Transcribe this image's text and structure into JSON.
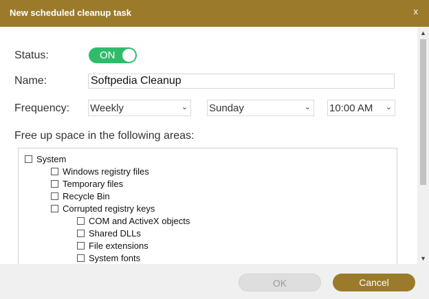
{
  "window": {
    "title": "New scheduled cleanup task",
    "close_label": "x"
  },
  "status": {
    "label": "Status:",
    "toggle_text": "ON"
  },
  "name": {
    "label": "Name:",
    "value": "Softpedia Cleanup"
  },
  "frequency": {
    "label": "Frequency:",
    "period": "Weekly",
    "day": "Sunday",
    "time": "10:00 AM"
  },
  "areas": {
    "heading": "Free up space in the following areas:",
    "items": [
      {
        "label": "System",
        "level": 0,
        "checked": false
      },
      {
        "label": "Windows registry files",
        "level": 1,
        "checked": false
      },
      {
        "label": "Temporary files",
        "level": 1,
        "checked": false
      },
      {
        "label": "Recycle Bin",
        "level": 1,
        "checked": false
      },
      {
        "label": "Corrupted registry keys",
        "level": 1,
        "checked": false
      },
      {
        "label": "COM and ActiveX objects",
        "level": 2,
        "checked": false
      },
      {
        "label": "Shared DLLs",
        "level": 2,
        "checked": false
      },
      {
        "label": "File extensions",
        "level": 2,
        "checked": false
      },
      {
        "label": "System fonts",
        "level": 2,
        "checked": false
      }
    ]
  },
  "buttons": {
    "ok": "OK",
    "cancel": "Cancel"
  },
  "colors": {
    "accent": "#9b7b2b",
    "toggle_on": "#2ebc6b"
  }
}
